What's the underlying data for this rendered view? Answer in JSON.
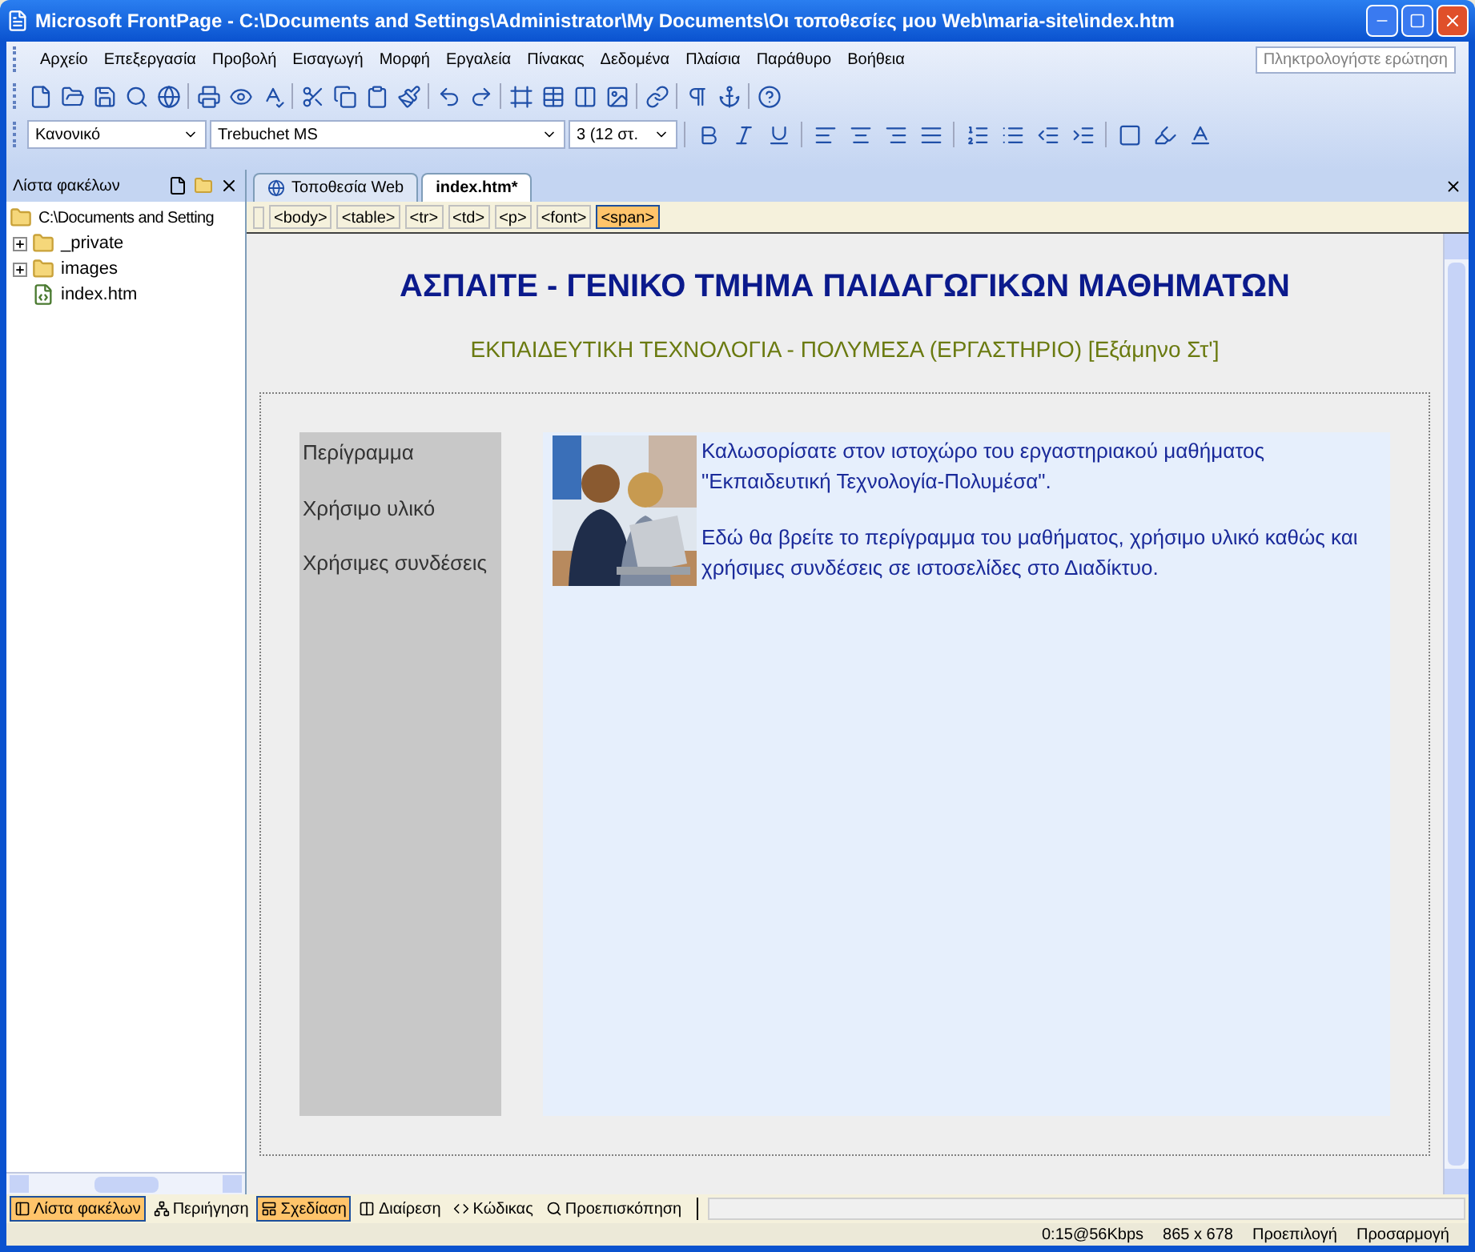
{
  "window": {
    "title": "Microsoft FrontPage - C:\\Documents and Settings\\Administrator\\My Documents\\Οι τοποθεσίες μου Web\\maria-site\\index.htm"
  },
  "menu": [
    "Αρχείο",
    "Επεξεργασία",
    "Προβολή",
    "Εισαγωγή",
    "Μορφή",
    "Εργαλεία",
    "Πίνακας",
    "Δεδομένα",
    "Πλαίσια",
    "Παράθυρο",
    "Βοήθεια"
  ],
  "help_search": {
    "placeholder": "Πληκτρολογήστε ερώτηση"
  },
  "formatting": {
    "style": "Κανονικό",
    "font": "Trebuchet MS",
    "size": "3 (12 στ."
  },
  "folder_list": {
    "title": "Λίστα φακέλων",
    "tree": [
      {
        "label": "C:\\Documents and Setting",
        "kind": "folder",
        "expanded": true,
        "children": [
          {
            "label": "_private",
            "kind": "folder",
            "expanded": false
          },
          {
            "label": "images",
            "kind": "folder",
            "expanded": false
          },
          {
            "label": "index.htm",
            "kind": "file"
          }
        ]
      }
    ]
  },
  "tabs": [
    {
      "label": "Τοποθεσία Web",
      "selected": false
    },
    {
      "label": "index.htm*",
      "selected": true
    }
  ],
  "tag_path": [
    {
      "label": "<body>",
      "selected": false
    },
    {
      "label": "<table>",
      "selected": false
    },
    {
      "label": "<tr>",
      "selected": false
    },
    {
      "label": "<td>",
      "selected": false
    },
    {
      "label": "<p>",
      "selected": false
    },
    {
      "label": "<font>",
      "selected": false
    },
    {
      "label": "<span>",
      "selected": true
    }
  ],
  "page": {
    "heading": "ΑΣΠΑΙΤΕ - ΓΕΝΙΚΟ ΤΜΗΜΑ ΠΑΙΔΑΓΩΓΙΚΩΝ ΜΑΘΗΜΑΤΩΝ",
    "subheading": "ΕΚΠΑΙΔΕΥΤΙΚΗ ΤΕΧΝΟΛΟΓΙΑ - ΠΟΛΥΜΕΣΑ (ΕΡΓΑΣΤΗΡΙΟ) [Εξάμηνο Στ']",
    "nav_links": [
      "Περίγραμμα",
      "Χρήσιμο υλικό",
      "Χρήσιμες συνδέσεις"
    ],
    "image": {
      "kind": "picture"
    },
    "paragraphs": [
      "Καλωσορίσατε στον ιστοχώρο του εργαστηριακού μαθήματος \"Εκπαιδευτική Τεχνολογία-Πολυμέσα\".",
      "Εδώ θα βρείτε το περίγραμμα του μαθήματος, χρήσιμο υλικό καθώς και χρήσιμες συνδέσεις σε ιστοσελίδες στο Διαδίκτυο."
    ]
  },
  "view_tabs": [
    {
      "label": "Λίστα φακέλων",
      "selected": true
    },
    {
      "label": "Περιήγηση",
      "selected": false
    },
    {
      "label": "Σχεδίαση",
      "selected": true
    },
    {
      "label": "Διαίρεση",
      "selected": false
    },
    {
      "label": "Κώδικας",
      "selected": false
    },
    {
      "label": "Προεπισκόπηση",
      "selected": false
    }
  ],
  "status_bar": [
    "0:15@56Kbps",
    "865 x 678",
    "Προεπιλογή",
    "Προσαρμογή"
  ]
}
